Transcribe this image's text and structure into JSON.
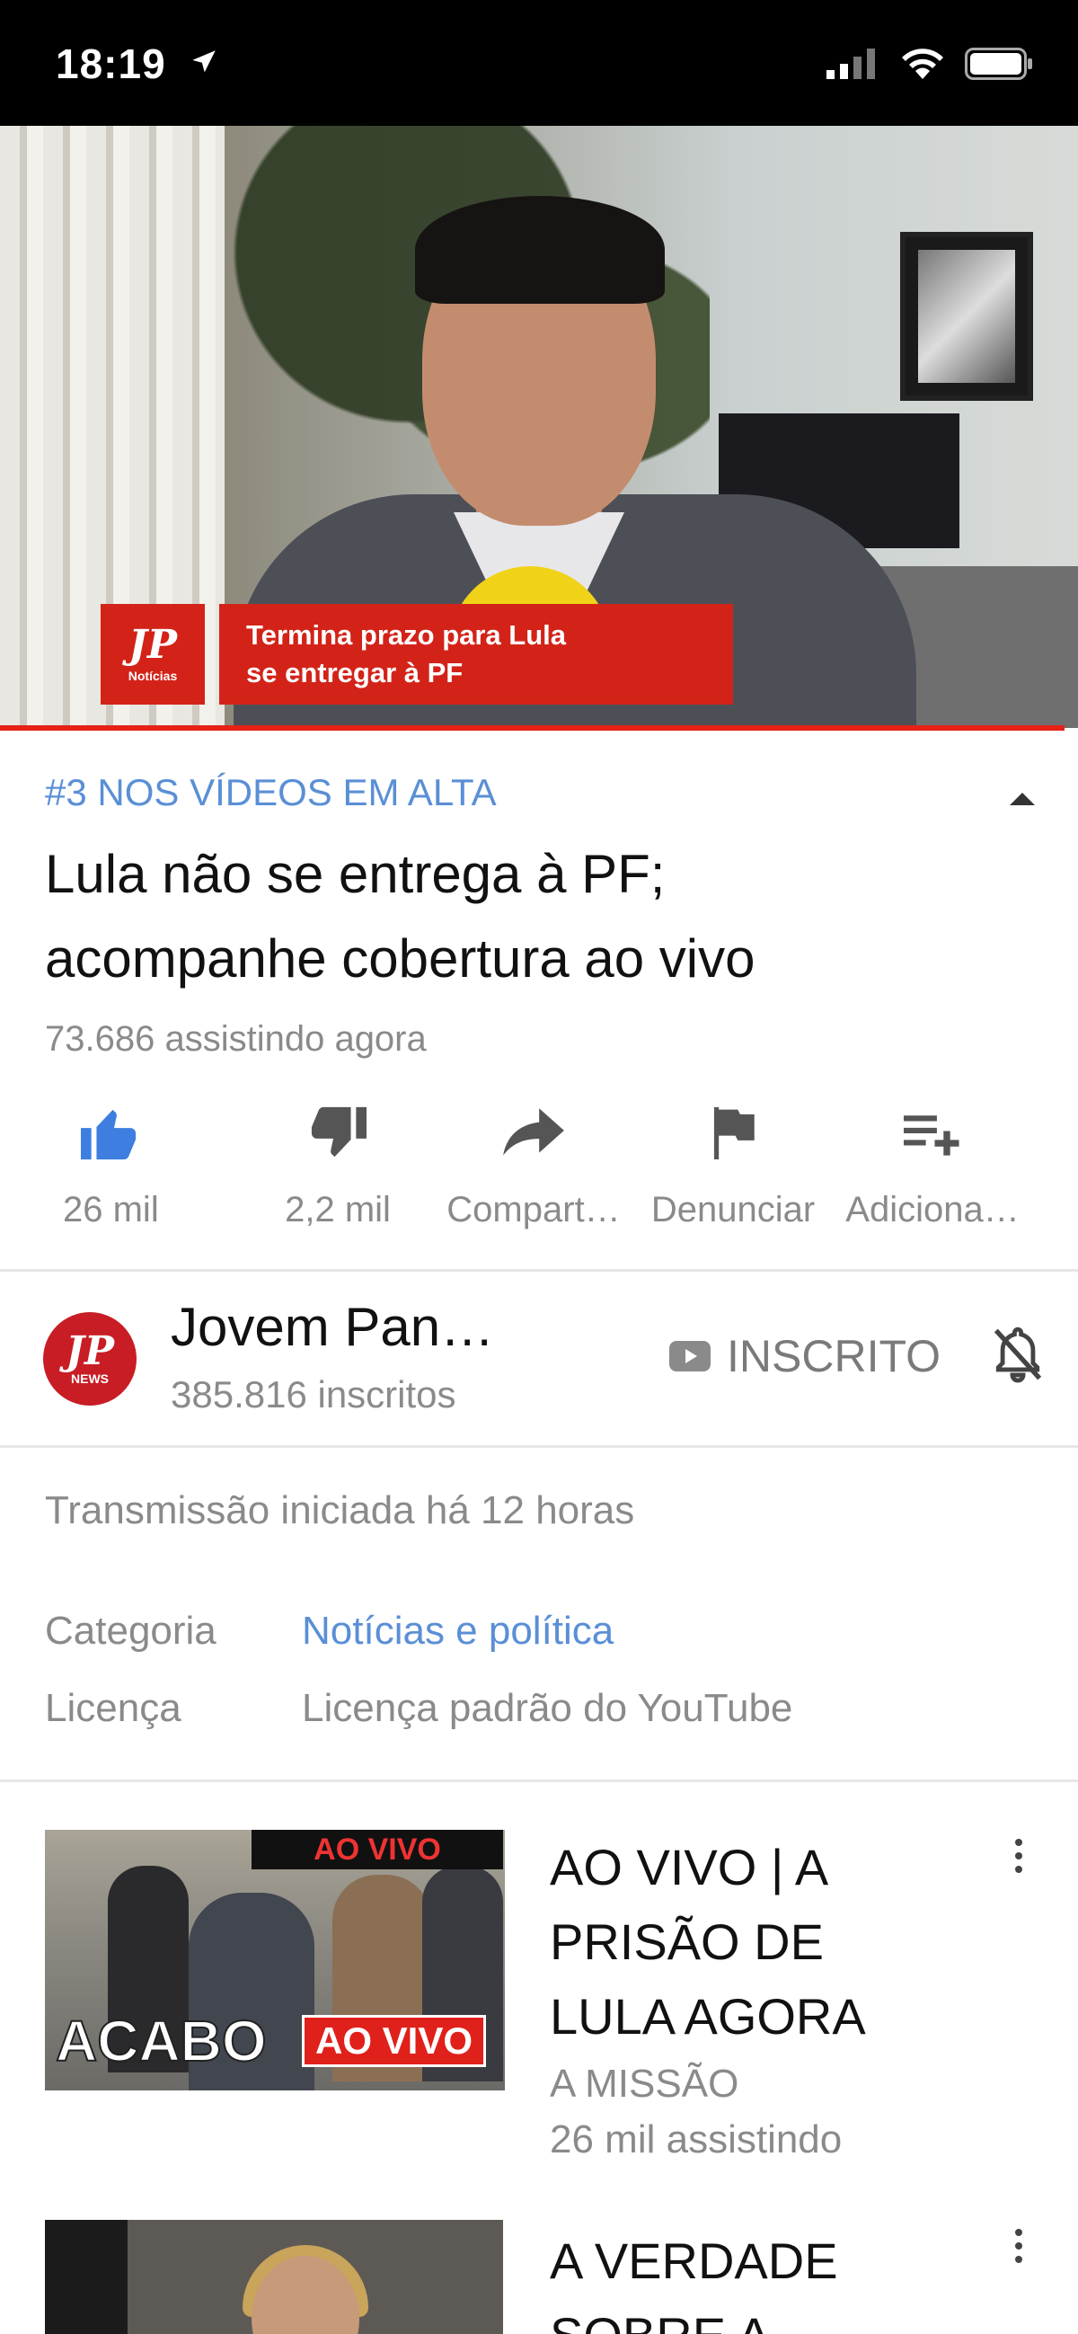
{
  "status_bar": {
    "time": "18:19"
  },
  "video": {
    "lower_third_logo": "JP",
    "lower_third_logo_sub": "Notícias",
    "lower_third_line1": "Termina prazo para Lula",
    "lower_third_line2": "se entregar à PF",
    "progress_color": "#e62117"
  },
  "info": {
    "trending": "#3 NOS VÍDEOS EM ALTA",
    "title_line1": "Lula não se entrega à PF;",
    "title_line2": "acompanhe cobertura ao vivo",
    "viewers": "73.686 assistindo agora"
  },
  "actions": [
    {
      "icon": "thumbs-up-icon",
      "label": "26 mil",
      "color": "#3d7ee0"
    },
    {
      "icon": "thumbs-down-icon",
      "label": "2,2 mil"
    },
    {
      "icon": "share-icon",
      "label": "Compart…"
    },
    {
      "icon": "flag-icon",
      "label": "Denunciar"
    },
    {
      "icon": "add-to-playlist-icon",
      "label": "Adiciona…"
    }
  ],
  "channel": {
    "avatar_text": "JP",
    "avatar_sub": "NEWS",
    "name": "Jovem Pan…",
    "subscribers": "385.816 inscritos",
    "subscribed_label": "INSCRITO"
  },
  "details": {
    "broadcast": "Transmissão iniciada há 12 horas",
    "category_label": "Categoria",
    "category_value": "Notícias e política",
    "license_label": "Licença",
    "license_value": "Licença padrão do YouTube"
  },
  "suggested": [
    {
      "thumb_tag": "AO VIVO",
      "thumb_big": "ACABO",
      "thumb_badge": "AO VIVO",
      "title_line1": "AO VIVO | A",
      "title_line2": "PRISÃO DE",
      "title_line3": "LULA AGORA",
      "channel": "A MISSÃO",
      "views": "26 mil assistindo"
    },
    {
      "title_line1": "A VERDADE",
      "title_line2": "SOBRE A"
    }
  ]
}
